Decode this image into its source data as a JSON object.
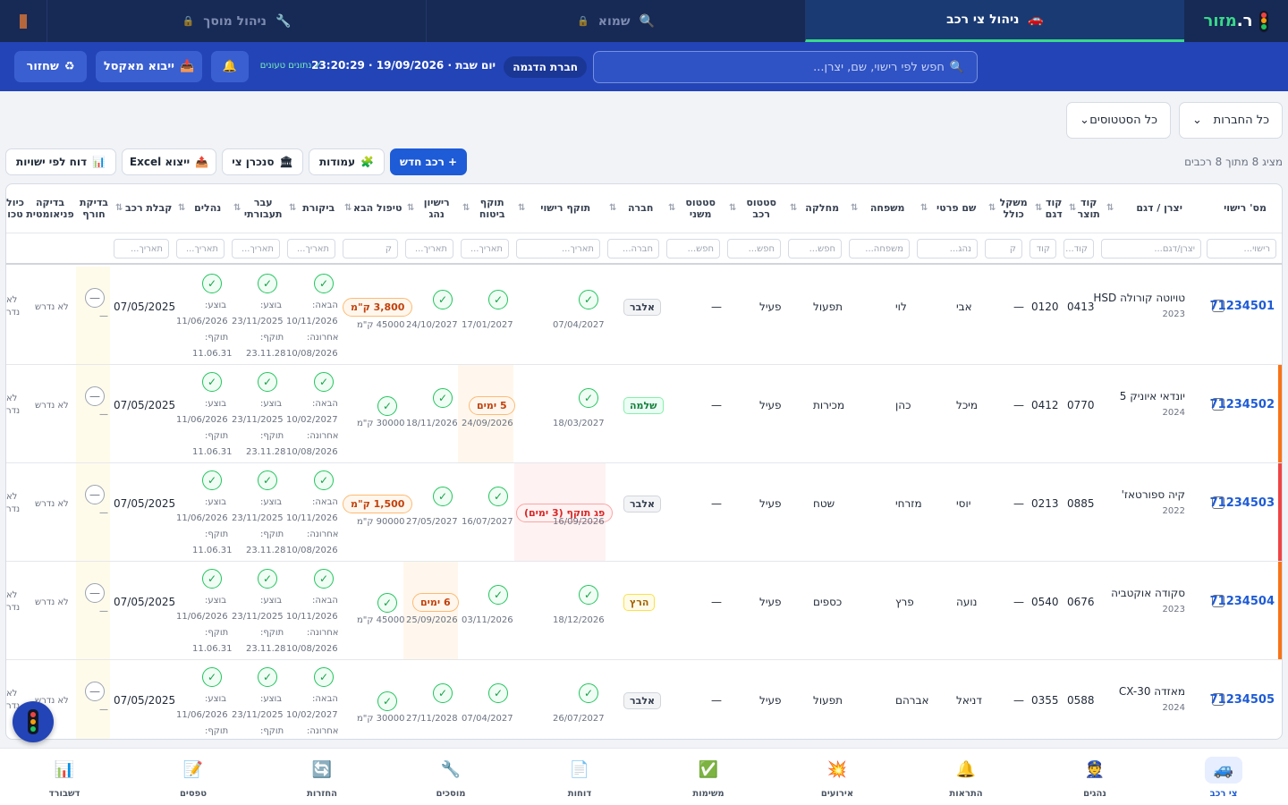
{
  "app": {
    "brand_prefix": "ר.",
    "brand_suffix": "מזור"
  },
  "tabs": [
    {
      "label": "ניהול צי רכב",
      "icon": "🚗"
    },
    {
      "label": "שמוא",
      "icon": "🔍"
    },
    {
      "label": "ניהול מוסך",
      "icon": "🔧"
    }
  ],
  "header": {
    "search_placeholder": "חפש לפי רישוי, שם, יצרן...",
    "company": "חברת הדגמה",
    "datetime": "יום שבת · 19/09/2026 · 23:20:29",
    "loaded": "✓ נתונים טעונים",
    "import_label": "ייבוא מאקסל",
    "restore_label": "שחזור"
  },
  "filters": {
    "companies": "כל החברות",
    "statuses": "כל הסטטוסים"
  },
  "toolbar": {
    "count": "מציג 8 מתוך 8 רכבים",
    "new_vehicle": "+ רכב חדש",
    "columns": "עמודות",
    "sync": "סנכרן צי",
    "export": "ייצוא Excel",
    "report": "דוח לפי ישויות"
  },
  "columns": [
    {
      "label": "מס' רישוי"
    },
    {
      "label": "יצרן / דגם"
    },
    {
      "label": "קוד תוצר"
    },
    {
      "label": "קוד דגם"
    },
    {
      "label": "משקל כולל"
    },
    {
      "label": "שם פרטי"
    },
    {
      "label": "משפחה"
    },
    {
      "label": "מחלקה"
    },
    {
      "label": "סטטוס רכב"
    },
    {
      "label": "סטטוס משני"
    },
    {
      "label": "חברה"
    },
    {
      "label": "תוקף רישוי"
    },
    {
      "label": "תוקף ביטוח"
    },
    {
      "label": "רישיון נהג"
    },
    {
      "label": "טיפול הבא"
    },
    {
      "label": "ביקורת"
    },
    {
      "label": "עבר תעבורתי"
    },
    {
      "label": "נהלים"
    },
    {
      "label": "קבלת רכב"
    },
    {
      "label": "בדיקת חורף"
    },
    {
      "label": "בדיקה פניאומטית"
    },
    {
      "label": "כיול טכו"
    }
  ],
  "filter_placeholders": {
    "plate": "רישוי...",
    "model": "יצרן/דגם...",
    "code": "קוד...",
    "short_code": "קוד",
    "weight": "ק",
    "first": "נהג...",
    "family": "משפחה...",
    "search": "חפש...",
    "company": "חברה...",
    "date": "תאריך...",
    "km": "ק"
  },
  "row_labels": {
    "next": "הבאה:",
    "last": "אחרונה:",
    "done": "בוצע:",
    "valid": "תוקף:",
    "not_required": "לא נדרש",
    "active": "פעיל",
    "dash": "—",
    "check": "✓",
    "partial_1": "לא",
    "partial_2": "נדר"
  },
  "rows": [
    {
      "plate": "71234501",
      "model": "טויוטה קורולה HSD",
      "year": "2023",
      "prod_code": "0413",
      "model_code": "0120",
      "first": "אבי",
      "last": "לוי",
      "dept": "תפעול",
      "company": "אלבר",
      "license": "07/04/2027",
      "insurance": "17/01/2027",
      "driver_lic": "24/10/2027",
      "service_badge": "3,800 ק\"מ",
      "service_km": "45000 ק\"מ",
      "inspect_next": "10/11/2026",
      "inspect_last": "10/08/2026",
      "traffic_done": "23/11/2025",
      "traffic_valid": "23.11.28",
      "proc_done": "11/06/2026",
      "proc_valid": "11.06.31",
      "receipt": "07/05/2025"
    },
    {
      "plate": "71234502",
      "model": "יונדאי איוניק 5",
      "year": "2024",
      "prod_code": "0770",
      "model_code": "0412",
      "first": "מיכל",
      "last": "כהן",
      "dept": "מכירות",
      "company": "שלמה",
      "license": "18/03/2027",
      "insurance_badge": "5 ימים",
      "insurance": "24/09/2026",
      "driver_lic": "18/11/2026",
      "service_km": "30000 ק\"מ",
      "inspect_next": "10/02/2027",
      "inspect_last": "10/08/2026",
      "traffic_done": "23/11/2025",
      "traffic_valid": "23.11.28",
      "proc_done": "11/06/2026",
      "proc_valid": "11.06.31",
      "receipt": "07/05/2025"
    },
    {
      "plate": "71234503",
      "model": "קיה ספורטאז'",
      "year": "2022",
      "prod_code": "0885",
      "model_code": "0213",
      "first": "יוסי",
      "last": "מזרחי",
      "dept": "שטח",
      "company": "אלבר",
      "license_badge": "פג תוקף (3 ימים)",
      "license": "16/09/2026",
      "insurance": "16/07/2027",
      "driver_lic": "27/05/2027",
      "service_badge": "1,500 ק\"מ",
      "service_km": "90000 ק\"מ",
      "inspect_next": "10/11/2026",
      "inspect_last": "10/08/2026",
      "traffic_done": "23/11/2025",
      "traffic_valid": "23.11.28",
      "proc_done": "11/06/2026",
      "proc_valid": "11.06.31",
      "receipt": "07/05/2025"
    },
    {
      "plate": "71234504",
      "model": "סקודה אוקטביה",
      "year": "2023",
      "prod_code": "0676",
      "model_code": "0540",
      "first": "נועה",
      "last": "פרץ",
      "dept": "כספים",
      "company": "הרץ",
      "license": "18/12/2026",
      "insurance": "03/11/2026",
      "driver_badge": "6 ימים",
      "driver_lic": "25/09/2026",
      "service_km": "45000 ק\"מ",
      "inspect_next": "10/11/2026",
      "inspect_last": "10/08/2026",
      "traffic_done": "23/11/2025",
      "traffic_valid": "23.11.28",
      "proc_done": "11/06/2026",
      "proc_valid": "11.06.31",
      "receipt": "07/05/2025"
    },
    {
      "plate": "71234505",
      "model": "מאזדה CX-30",
      "year": "2024",
      "prod_code": "0588",
      "model_code": "0355",
      "first": "דניאל",
      "last": "אברהם",
      "dept": "תפעול",
      "company": "אלבר",
      "license": "26/07/2027",
      "insurance": "07/04/2027",
      "driver_lic": "27/11/2028",
      "service_km": "30000 ק\"מ",
      "inspect_next": "10/02/2027",
      "inspect_last": "",
      "traffic_done": "23/11/2025",
      "traffic_valid": "",
      "proc_done": "11/06/2026",
      "proc_valid": "",
      "receipt": "07/05/2025"
    }
  ],
  "nav": [
    {
      "label": "צי רכב",
      "icon": "🚙"
    },
    {
      "label": "נהגים",
      "icon": "👮"
    },
    {
      "label": "התראות",
      "icon": "🔔"
    },
    {
      "label": "אירועים",
      "icon": "💥"
    },
    {
      "label": "משימות",
      "icon": "✅"
    },
    {
      "label": "דוחות",
      "icon": "📄"
    },
    {
      "label": "מוסכים",
      "icon": "🔧"
    },
    {
      "label": "החזרות",
      "icon": "🔄"
    },
    {
      "label": "טפסים",
      "icon": "📝"
    },
    {
      "label": "דשבורד",
      "icon": "📊"
    }
  ],
  "colors": {
    "accent": "#1e5bd6",
    "topbar": "#172a55",
    "subbar": "#2344b7",
    "ok": "#22c55e",
    "warn": "#f97316",
    "danger": "#ef4444"
  }
}
